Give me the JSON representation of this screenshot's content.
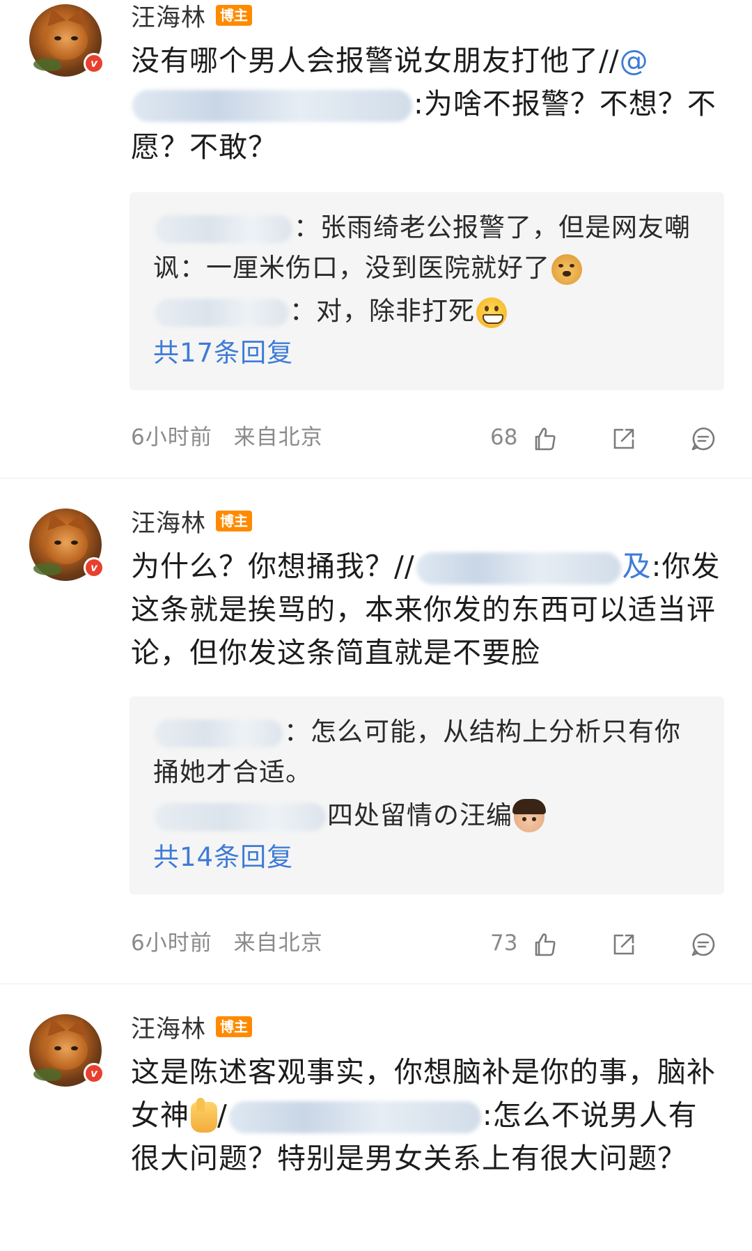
{
  "comments": [
    {
      "author": "汪海林",
      "tag": "博主",
      "text_pre": "没有哪个男人会报警说女朋友打他了//",
      "at_sign": "@",
      "text_post": ":为啥不报警？不想？不愿？不敢？",
      "replies": [
        {
          "text": "：张雨绮老公报警了，但是网友嘲讽：一厘米伤口，没到医院就好了",
          "emoji": "doge"
        },
        {
          "text": "：对，除非打死",
          "emoji": "grin"
        }
      ],
      "reply_count": "共17条回复",
      "time": "6小时前",
      "location": "来自北京",
      "likes": "68"
    },
    {
      "author": "汪海林",
      "tag": "博主",
      "text_pre": "为什么？你想捅我？//",
      "mention_tail": "及",
      "text_post": ":你发这条就是挨骂的，本来你发的东西可以适当评论，但你发这条简直就是不要脸",
      "replies": [
        {
          "text": "：怎么可能，从结构上分析只有你捅她才合适。",
          "emoji": ""
        },
        {
          "text": "四处留情の汪编",
          "emoji": "girl"
        }
      ],
      "reply_count": "共14条回复",
      "time": "6小时前",
      "location": "来自北京",
      "likes": "73"
    },
    {
      "author": "汪海林",
      "tag": "博主",
      "text_pre": "这是陈述客观事实，你想脑补是你的事，脑补女神",
      "emoji": "thumb",
      "text_mid": "/",
      "text_post": ":怎么不说男人有很大问题？特别是男女关系上有很大问题？"
    }
  ],
  "colors": {
    "link_blue": "#3e7bd6",
    "tag_orange": "#ff8a00",
    "verified_red": "#e8402e",
    "meta_gray": "#8a8a8a",
    "reply_bg": "#f5f5f5"
  },
  "icons": [
    "verified-v-icon",
    "like-icon",
    "share-icon",
    "comment-icon"
  ]
}
